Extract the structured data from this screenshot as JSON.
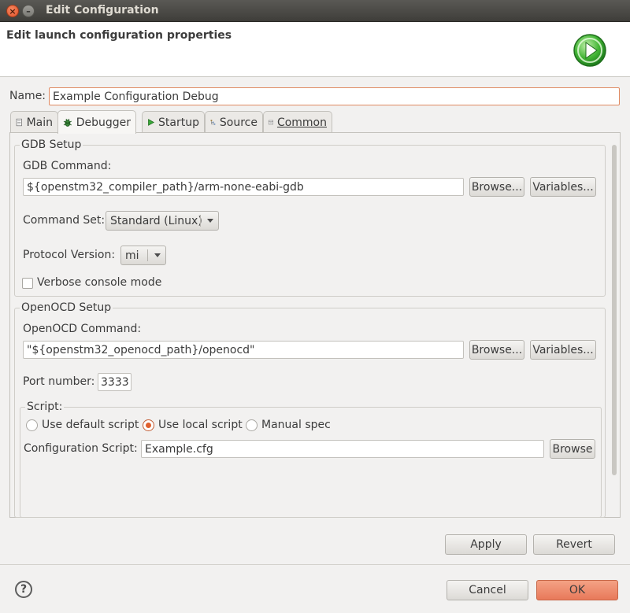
{
  "window": {
    "title": "Edit Configuration"
  },
  "header": {
    "title": "Edit launch configuration properties",
    "icon": "run-launch-icon",
    "icon_color": "#3aa83a"
  },
  "name": {
    "label": "Name:",
    "value": "Example Configuration Debug"
  },
  "tabs": [
    {
      "label": "Main",
      "icon": "main-tab-icon",
      "active": false
    },
    {
      "label": "Debugger",
      "icon": "debugger-bug-icon",
      "active": true
    },
    {
      "label": "Startup",
      "icon": "startup-play-icon",
      "active": false
    },
    {
      "label": "Source",
      "icon": "source-icon",
      "active": false
    },
    {
      "label": "Common",
      "icon": "common-icon",
      "active": false
    }
  ],
  "gdb": {
    "legend": "GDB Setup",
    "command_label": "GDB Command:",
    "command_value": "${openstm32_compiler_path}/arm-none-eabi-gdb",
    "browse_label": "Browse...",
    "variables_label": "Variables...",
    "command_set_label": "Command Set:",
    "command_set_value": "Standard (Linux)",
    "protocol_label": "Protocol Version:",
    "protocol_value": "mi",
    "verbose_label": "Verbose console mode",
    "verbose_checked": false
  },
  "openocd": {
    "legend": "OpenOCD Setup",
    "command_label": "OpenOCD Command:",
    "command_value": "\"${openstm32_openocd_path}/openocd\"",
    "browse_label": "Browse...",
    "variables_label": "Variables...",
    "port_label": "Port number:",
    "port_value": "3333"
  },
  "script": {
    "legend": "Script:",
    "options": [
      "Use default script",
      "Use local script",
      "Manual spec"
    ],
    "selected": "Use local script",
    "config_label": "Configuration Script:",
    "config_value": "Example.cfg",
    "browse_label": "Browse"
  },
  "actions": {
    "apply": "Apply",
    "revert": "Revert"
  },
  "dialog": {
    "cancel": "Cancel",
    "ok": "OK",
    "help": "?"
  }
}
